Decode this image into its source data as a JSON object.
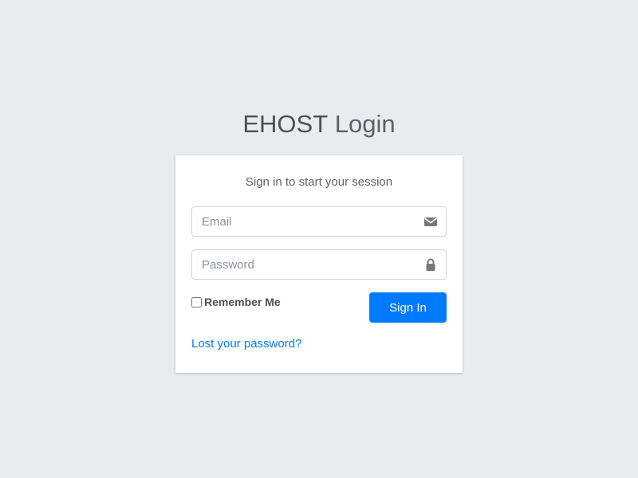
{
  "brand": {
    "strong": "EHOST",
    "light": "Login"
  },
  "card": {
    "message": "Sign in to start your session",
    "email": {
      "placeholder": "Email",
      "value": "",
      "icon": "envelope-icon"
    },
    "password": {
      "placeholder": "Password",
      "value": "",
      "icon": "lock-icon"
    },
    "remember_label": "Remember Me",
    "remember_checked": false,
    "signin_label": "Sign In",
    "lost_password_label": "Lost your password?"
  },
  "colors": {
    "background": "#e9ecef",
    "primary": "#007bff",
    "card": "#ffffff",
    "icon": "#777777"
  }
}
